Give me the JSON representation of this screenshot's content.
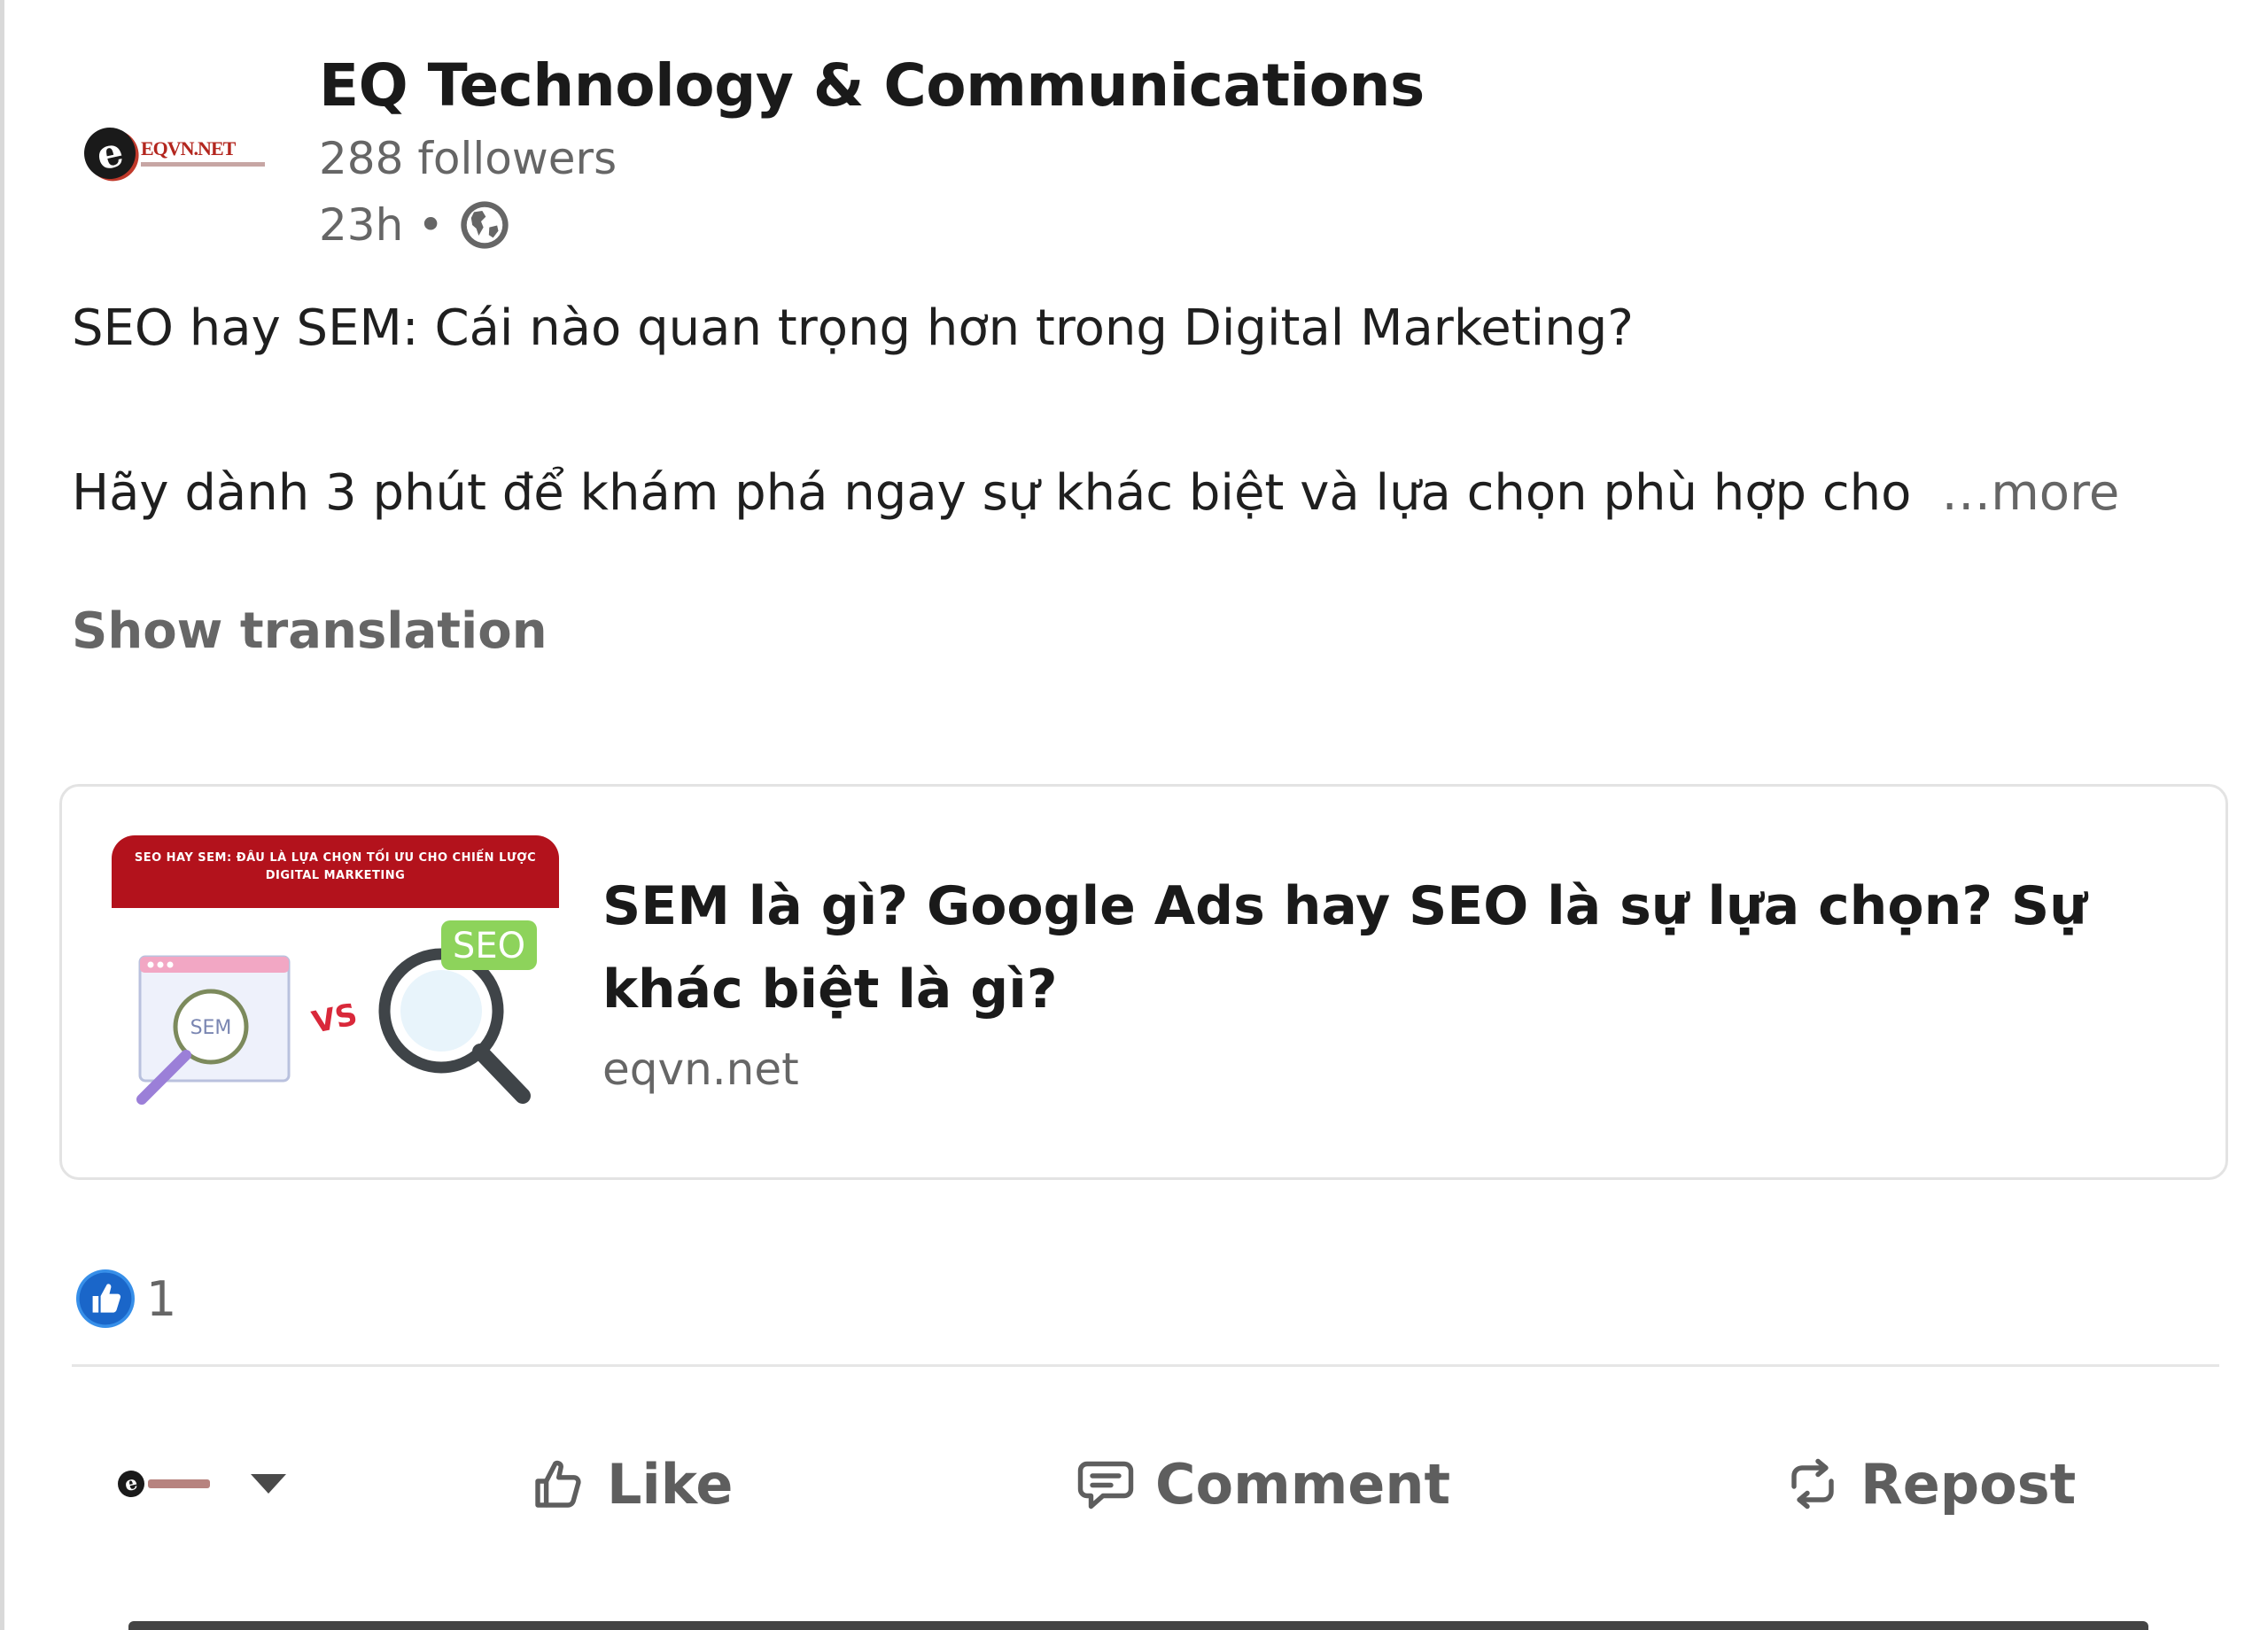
{
  "author": {
    "name": "EQ Technology & Communications",
    "followers": "288 followers",
    "time": "23h",
    "separator": "•",
    "visibility_icon": "globe-icon",
    "logo_text": "EQVN.NET"
  },
  "post": {
    "line1": "SEO hay SEM: Cái nào quan trọng hơn trong Digital Marketing?",
    "line2": "Hãy dành 3 phút để khám phá ngay sự khác biệt và lựa chọn phù hợp cho",
    "more_label": "…more",
    "show_translation": "Show translation"
  },
  "link_preview": {
    "title": "SEM là gì? Google Ads hay SEO là sự lựa chọn? Sự khác biệt là gì?",
    "domain": "eqvn.net",
    "thumb_banner": "SEO HAY SEM: ĐÂU LÀ LỰA CHỌN TỐI ƯU CHO CHIẾN LƯỢC DIGITAL MARKETING",
    "thumb_sem": "SEM",
    "thumb_vs": "VS",
    "thumb_seo": "SEO"
  },
  "reactions": {
    "icon": "like-reaction-icon",
    "count": "1"
  },
  "actions": {
    "like": "Like",
    "comment": "Comment",
    "repost": "Repost"
  },
  "colors": {
    "brand_red": "#b3121c",
    "reaction_blue": "#378fe9",
    "secondary_text": "#666666"
  }
}
